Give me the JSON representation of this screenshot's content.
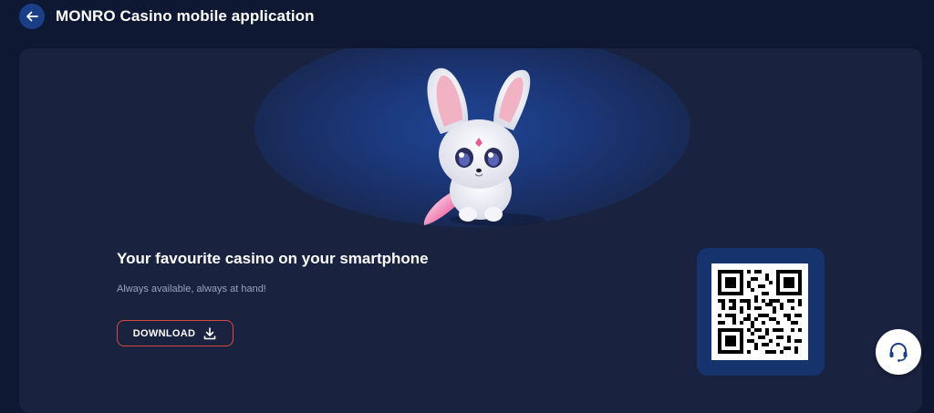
{
  "header": {
    "title": "MONRO Casino mobile application",
    "back_icon": "arrow-left-icon"
  },
  "promo": {
    "headline": "Your favourite casino on your smartphone",
    "subline": "Always available, always at hand!",
    "download_label": "DOWNLOAD",
    "download_icon": "download-icon"
  },
  "qr": {
    "icon": "qr-code"
  },
  "support": {
    "icon": "headset-icon"
  },
  "colors": {
    "background": "#0f1833",
    "card": "#19223f",
    "accent_blue": "#1b3f86",
    "download_border": "#d94a3e",
    "qr_panel": "#17336e"
  }
}
